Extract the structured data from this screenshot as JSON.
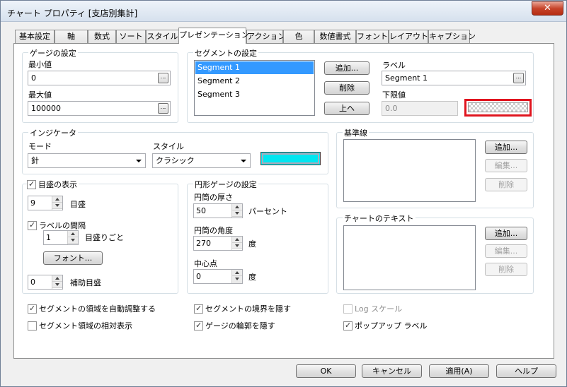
{
  "window": {
    "title": "チャート プロパティ [支店別集計]",
    "close_glyph": "✕"
  },
  "tabs": [
    {
      "label": "基本設定"
    },
    {
      "label": "軸"
    },
    {
      "label": "数式"
    },
    {
      "label": "ソート"
    },
    {
      "label": "スタイル"
    },
    {
      "label": "プレゼンテーション"
    },
    {
      "label": "アクション"
    },
    {
      "label": "色"
    },
    {
      "label": "数値書式"
    },
    {
      "label": "フォント"
    },
    {
      "label": "レイアウト"
    },
    {
      "label": "キャプション"
    }
  ],
  "active_tab": "プレゼンテーション",
  "gauge": {
    "title": "ゲージの設定",
    "min_label": "最小値",
    "min_value": "0",
    "max_label": "最大値",
    "max_value": "100000",
    "ellipsis": "..."
  },
  "segments": {
    "title": "セグメントの設定",
    "items": [
      "Segment 1",
      "Segment 2",
      "Segment 3"
    ],
    "selected": "Segment 1",
    "add": "追加...",
    "delete": "削除",
    "up": "上へ",
    "label_caption": "ラベル",
    "label_value": "Segment 1",
    "lower_caption": "下限値",
    "lower_value": "0.0"
  },
  "indicator": {
    "title": "インジケータ",
    "mode_label": "モード",
    "mode_value": "針",
    "style_label": "スタイル",
    "style_value": "クラシック",
    "color": "#00e6f0"
  },
  "baseline": {
    "title": "基準線",
    "add": "追加...",
    "edit": "編集...",
    "delete": "削除"
  },
  "chart_text": {
    "title": "チャートのテキスト",
    "add": "追加...",
    "edit": "編集...",
    "delete": "削除"
  },
  "ticks": {
    "show_label": "目盛の表示",
    "show_checked": true,
    "count": "9",
    "count_unit": "目盛",
    "interval_label": "ラベルの間隔",
    "interval_checked": true,
    "interval": "1",
    "interval_unit": "目盛りごと",
    "font": "フォント...",
    "minor": "0",
    "minor_unit": "補助目盛"
  },
  "circle": {
    "title": "円形ゲージの設定",
    "thickness_label": "円筒の厚さ",
    "thickness": "50",
    "thickness_unit": "パーセント",
    "angle_label": "円筒の角度",
    "angle": "270",
    "angle_unit": "度",
    "center_label": "中心点",
    "center": "0",
    "center_unit": "度"
  },
  "options": {
    "autofit": "セグメントの領域を自動調整する",
    "relative": "セグメント領域の相対表示",
    "hide_border": "セグメントの境界を隠す",
    "hide_outline": "ゲージの輪郭を隠す",
    "log_scale": "Log スケール",
    "popup": "ポップアップ ラベル"
  },
  "buttons": {
    "ok": "OK",
    "cancel": "キャンセル",
    "apply": "適用(A)",
    "help": "ヘルプ"
  }
}
